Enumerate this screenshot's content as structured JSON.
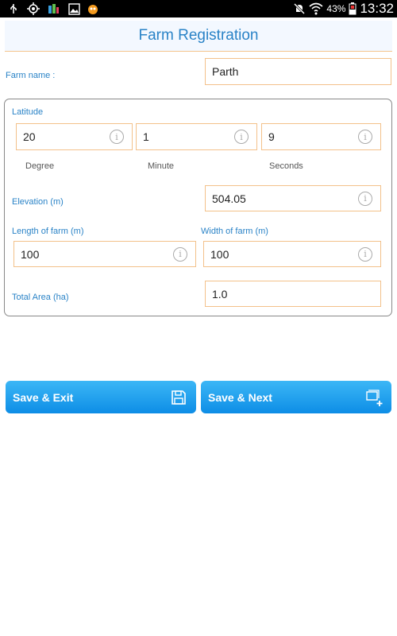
{
  "status_bar": {
    "icons": [
      "usb-icon",
      "gps-icon",
      "app-icon",
      "image-icon",
      "uc-browser-icon"
    ],
    "battery_percent": "43%",
    "time": "13:32"
  },
  "header": {
    "title": "Farm Registration"
  },
  "farm_name": {
    "label": "Farm name :",
    "value": "Parth"
  },
  "latitude": {
    "label": "Latitude",
    "degree": {
      "value": "20",
      "label": "Degree"
    },
    "minute": {
      "value": "1",
      "label": "Minute"
    },
    "seconds": {
      "value": "9",
      "label": "Seconds"
    }
  },
  "elevation": {
    "label": "Elevation (m)",
    "value": "504.05"
  },
  "length": {
    "label": "Length of farm (m)",
    "value": "100"
  },
  "width": {
    "label": "Width of farm (m)",
    "value": "100"
  },
  "total_area": {
    "label": "Total Area (ha)",
    "value": "1.0"
  },
  "buttons": {
    "save_exit": "Save & Exit",
    "save_next": "Save & Next"
  },
  "colors": {
    "accent": "#2a83c7",
    "field_border": "#f3c18a",
    "button_top": "#3cb7f6",
    "button_bottom": "#0d8de6"
  }
}
